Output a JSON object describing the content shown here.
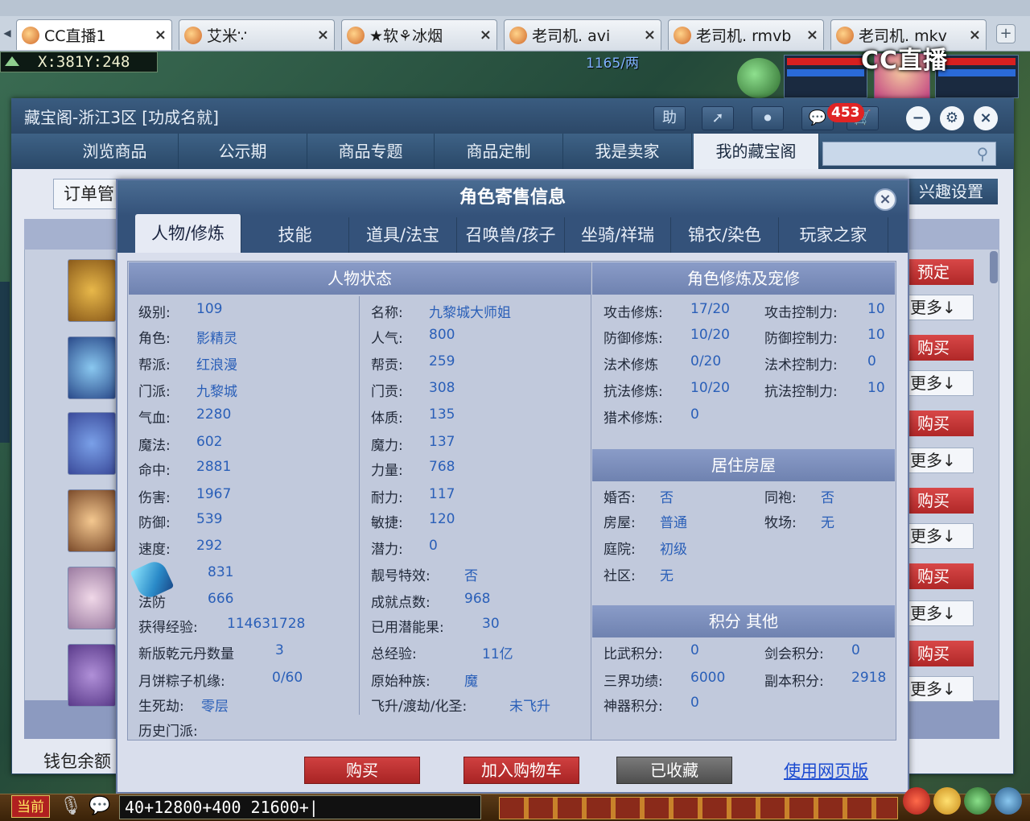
{
  "browser": {
    "tabs": [
      {
        "label": "CC直播1",
        "active": true
      },
      {
        "label": "艾米∵",
        "active": false
      },
      {
        "label": "★软⚘冰烟",
        "active": false
      },
      {
        "label": "老司机. avi",
        "active": false
      },
      {
        "label": "老司机. rmvb",
        "active": false
      },
      {
        "label": "老司机. mkv",
        "active": false
      }
    ],
    "close_glyph": "×",
    "add_glyph": "+"
  },
  "game_hud": {
    "coordinates": "X:381Y:248",
    "scroll_text": "1165/两",
    "cc_logo": "CC直播"
  },
  "window": {
    "title": "藏宝阁-浙江3区 [功成名就]",
    "title_buttons": [
      "助",
      "➚",
      "⏺",
      "💬",
      "🛒"
    ],
    "badge_count": "453",
    "window_controls": [
      "−",
      "⚙",
      "×"
    ],
    "nav": [
      {
        "label": "浏览商品",
        "active": false
      },
      {
        "label": "公示期",
        "active": false
      },
      {
        "label": "商品专题",
        "active": false
      },
      {
        "label": "商品定制",
        "active": false
      },
      {
        "label": "我是卖家",
        "active": false
      },
      {
        "label": "我的藏宝阁",
        "active": true
      }
    ],
    "search_placeholder": "",
    "order_tab": "订单管",
    "interest_button": "兴趣设置",
    "wallet_label": "钱包余额"
  },
  "listing": {
    "side_buttons": [
      {
        "primary": "预定",
        "more": "更多↓"
      },
      {
        "primary": "购买",
        "more": "更多↓"
      },
      {
        "primary": "购买",
        "more": "更多↓"
      },
      {
        "primary": "购买",
        "more": "更多↓"
      },
      {
        "primary": "购买",
        "more": "更多↓"
      },
      {
        "primary": "购买",
        "more": "更多↓"
      }
    ]
  },
  "modal": {
    "title": "角色寄售信息",
    "close": "×",
    "tabs": [
      "人物/修炼",
      "技能",
      "道具/法宝",
      "召唤兽/孩子",
      "坐骑/祥瑞",
      "锦衣/染色",
      "玩家之家"
    ],
    "active_tab": 0,
    "status_header": "人物状态",
    "status_left": [
      {
        "label": "级别:",
        "value": "109"
      },
      {
        "label": "角色:",
        "value": "影精灵"
      },
      {
        "label": "帮派:",
        "value": "红浪漫"
      },
      {
        "label": "门派:",
        "value": "九黎城"
      },
      {
        "label": "气血:",
        "value": "2280"
      },
      {
        "label": "魔法:",
        "value": "602"
      },
      {
        "label": "命中:",
        "value": "2881"
      },
      {
        "label": "伤害:",
        "value": "1967"
      },
      {
        "label": "防御:",
        "value": "539"
      },
      {
        "label": "速度:",
        "value": "292"
      },
      {
        "label": "法伤",
        "value": "831"
      },
      {
        "label": "法防",
        "value": "666"
      },
      {
        "label": "获得经验:",
        "value": "114631728"
      },
      {
        "label": "新版乾元丹数量",
        "value": "3"
      },
      {
        "label": "月饼粽子机缘:",
        "value": "0/60"
      },
      {
        "label": "生死劫:",
        "value": "零层"
      },
      {
        "label": "历史门派:",
        "value": ""
      }
    ],
    "status_right": [
      {
        "label": "名称:",
        "value": "九黎城大师姐"
      },
      {
        "label": "人气:",
        "value": "800"
      },
      {
        "label": "帮贡:",
        "value": "259"
      },
      {
        "label": "门贡:",
        "value": "308"
      },
      {
        "label": "体质:",
        "value": "135"
      },
      {
        "label": "魔力:",
        "value": "137"
      },
      {
        "label": "力量:",
        "value": "768"
      },
      {
        "label": "耐力:",
        "value": "117"
      },
      {
        "label": "敏捷:",
        "value": "120"
      },
      {
        "label": "潜力:",
        "value": "0"
      },
      {
        "label": "靓号特效:",
        "value": "否"
      },
      {
        "label": "成就点数:",
        "value": "968"
      },
      {
        "label": "已用潜能果:",
        "value": "30"
      },
      {
        "label": "总经验:",
        "value": "11亿"
      },
      {
        "label": "原始种族:",
        "value": "魔"
      },
      {
        "label": "飞升/渡劫/化圣:",
        "value": "未飞升"
      }
    ],
    "cultivation_header": "角色修炼及宠修",
    "cultivation": [
      {
        "label": "攻击修炼:",
        "value": "17/20",
        "label2": "攻击控制力:",
        "value2": "10"
      },
      {
        "label": "防御修炼:",
        "value": "10/20",
        "label2": "防御控制力:",
        "value2": "10"
      },
      {
        "label": "法术修炼",
        "value": "0/20",
        "label2": "法术控制力:",
        "value2": "0"
      },
      {
        "label": "抗法修炼:",
        "value": "10/20",
        "label2": "抗法控制力:",
        "value2": "10"
      },
      {
        "label": "猎术修炼:",
        "value": "0",
        "label2": "",
        "value2": ""
      }
    ],
    "house_header": "居住房屋",
    "house": [
      {
        "label": "婚否:",
        "value": "否",
        "label2": "同袍:",
        "value2": "否"
      },
      {
        "label": "房屋:",
        "value": "普通",
        "label2": "牧场:",
        "value2": "无"
      },
      {
        "label": "庭院:",
        "value": "初级",
        "label2": "",
        "value2": ""
      },
      {
        "label": "社区:",
        "value": "无",
        "label2": "",
        "value2": ""
      }
    ],
    "points_header": "积分 其他",
    "points": [
      {
        "label": "比武积分:",
        "value": "0",
        "label2": "剑会积分:",
        "value2": "0"
      },
      {
        "label": "三界功绩:",
        "value": "6000",
        "label2": "副本积分:",
        "value2": "2918"
      },
      {
        "label": "神器积分:",
        "value": "0",
        "label2": "",
        "value2": ""
      }
    ],
    "buttons": {
      "buy": "购买",
      "add_cart": "加入购物车",
      "favorited": "已收藏",
      "web_link": "使用网页版"
    }
  },
  "game_bottom": {
    "channel": "当前",
    "chat_text": "40+12800+400 21600+|"
  }
}
